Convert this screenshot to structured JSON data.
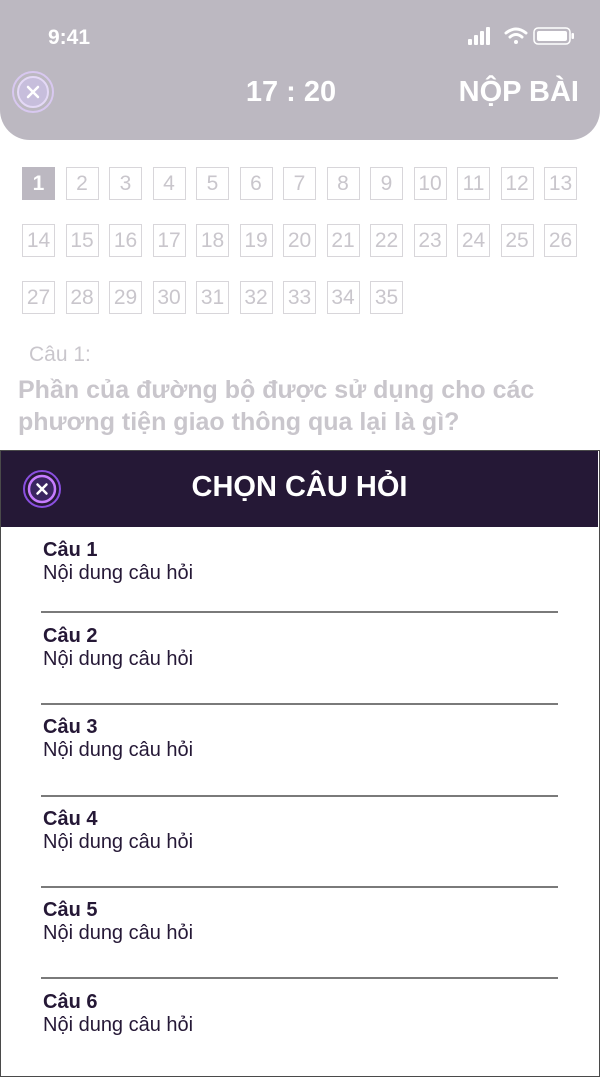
{
  "status_bar": {
    "time": "9:41"
  },
  "header": {
    "timer": "17 : 20",
    "submit_label": "NỘP BÀI"
  },
  "question_numbers": [
    "1",
    "2",
    "3",
    "4",
    "5",
    "6",
    "7",
    "8",
    "9",
    "10",
    "11",
    "12",
    "13",
    "14",
    "15",
    "16",
    "17",
    "18",
    "19",
    "20",
    "21",
    "22",
    "23",
    "24",
    "25",
    "26",
    "27",
    "28",
    "29",
    "30",
    "31",
    "32",
    "33",
    "34",
    "35"
  ],
  "active_question": "1",
  "question": {
    "label": "Câu 1:",
    "text": "Phần của đường bộ được sử dụng cho các phương tiện giao thông qua lại là gì?"
  },
  "panel": {
    "title": "CHỌN CÂU HỎI",
    "items": [
      {
        "title": "Câu 1",
        "subtitle": "Nội dung câu hỏi"
      },
      {
        "title": "Câu 2",
        "subtitle": "Nội dung câu hỏi"
      },
      {
        "title": "Câu 3",
        "subtitle": "Nội dung câu hỏi"
      },
      {
        "title": "Câu 4",
        "subtitle": "Nội dung câu hỏi"
      },
      {
        "title": "Câu 5",
        "subtitle": "Nội dung câu hỏi"
      },
      {
        "title": "Câu 6",
        "subtitle": "Nội dung câu hỏi"
      }
    ]
  },
  "colors": {
    "header_bg": "#bcb8c1",
    "panel_header_bg": "#251836",
    "accent_ring": "#9b5cf0"
  },
  "icons": {
    "status": [
      "signal-icon",
      "wifi-icon",
      "battery-icon"
    ],
    "close": "close-icon"
  }
}
